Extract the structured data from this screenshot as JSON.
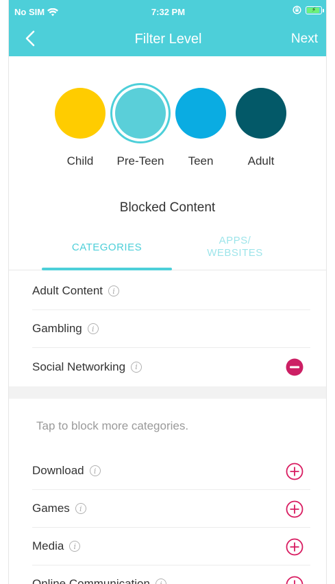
{
  "status": {
    "carrier": "No SIM",
    "time": "7:32 PM"
  },
  "nav": {
    "title": "Filter Level",
    "next_label": "Next"
  },
  "levels": [
    {
      "label": "Child",
      "color": "#ffcc00",
      "selected": false
    },
    {
      "label": "Pre-Teen",
      "color": "#5acfd9",
      "selected": true
    },
    {
      "label": "Teen",
      "color": "#0aace2",
      "selected": false
    },
    {
      "label": "Adult",
      "color": "#035968",
      "selected": false
    }
  ],
  "blocked_content_title": "Blocked Content",
  "tabs": {
    "categories": "CATEGORIES",
    "apps_line1": "APPS/",
    "apps_line2": "WEBSITES"
  },
  "blocked_categories": [
    "Adult Content",
    "Gambling",
    "Social Networking"
  ],
  "hint": "Tap to block more categories.",
  "more_categories": [
    "Download",
    "Games",
    "Media",
    "Online Communication"
  ],
  "colors": {
    "accent": "#4dcfd9",
    "remove": "#cc1f64",
    "add": "#d81b60"
  },
  "icons": {
    "info": "info-icon",
    "remove": "minus-circle-icon",
    "add": "plus-circle-icon"
  }
}
